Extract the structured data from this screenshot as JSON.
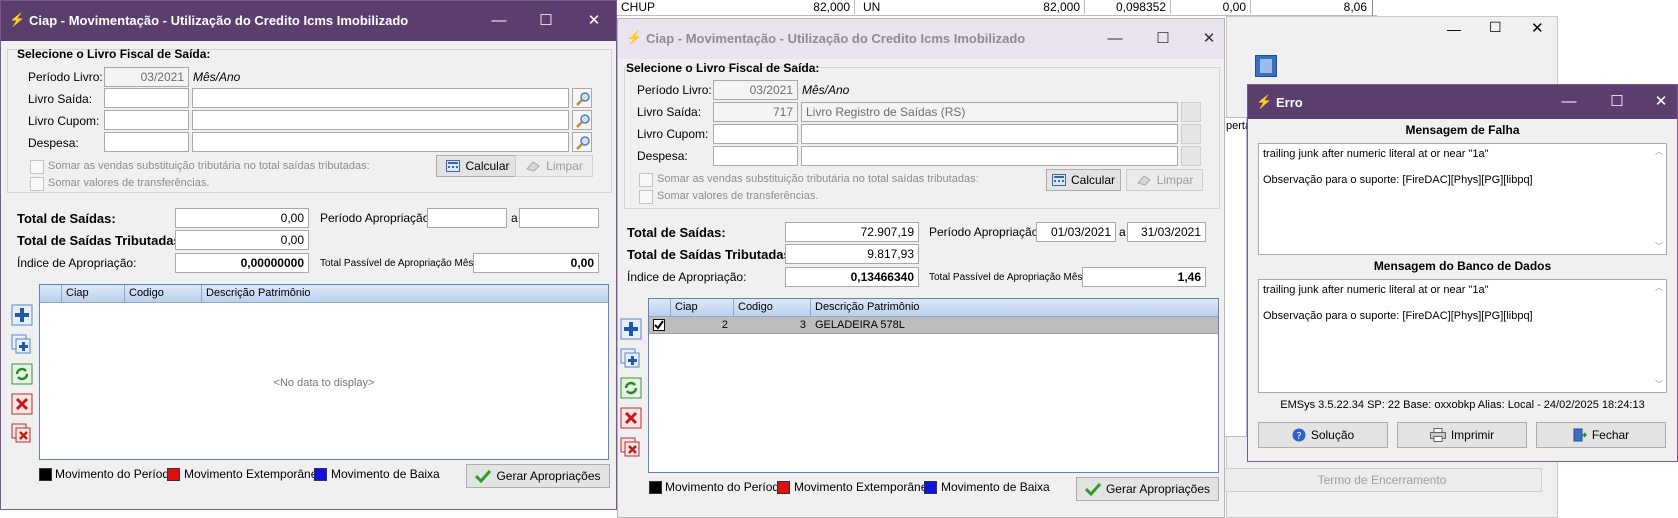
{
  "background": {
    "top_row": {
      "c1": "CHUP",
      "c2": "82,000",
      "c3": "UN",
      "c4": "82,000",
      "c5": "0,098352",
      "c6": "0,00",
      "c7": "8,06"
    },
    "tab_partial": "perta",
    "footer_button": "Termo de Encerramento"
  },
  "window1": {
    "title": "Ciap - Movimentação - Utilização do Credito Icms Imobilizado",
    "section_title": "Selecione o Livro Fiscal de Saída:",
    "periodo_label": "Período Livro:",
    "periodo_value": "03/2021",
    "mes_ano": "Mês/Ano",
    "livro_saida_label": "Livro Saída:",
    "livro_saida_code": "",
    "livro_saida_desc": "",
    "livro_cupom_label": "Livro Cupom:",
    "despesa_label": "Despesa:",
    "chk1_label": "Somar as vendas substituição tributária no total saídas tributadas:",
    "chk2_label": "Somar valores de transferências.",
    "calcular": "Calcular",
    "limpar": "Limpar",
    "total_saidas_label": "Total de Saídas:",
    "total_saidas_value": "0,00",
    "total_trib_label": "Total de Saídas Tributadas:",
    "total_trib_value": "0,00",
    "indice_label": "Índice de Apropriação:",
    "indice_value": "0,00000000",
    "periodo_aprop_label": "Período Apropriação:",
    "periodo_aprop_from": "",
    "a_label": "a",
    "periodo_aprop_to": "",
    "passivel_label": "Total Passível de Apropriação Mês:",
    "passivel_value": "0,00",
    "grid_cols": [
      "Ciap",
      "Codigo",
      "Descrição Patrimônio"
    ],
    "no_data": "<No data to display>",
    "legend": [
      "Movimento do Período",
      "Movimento Extemporâneo",
      "Movimento de Baixa"
    ],
    "gerar": "Gerar Apropriações"
  },
  "window2": {
    "title": "Ciap - Movimentação - Utilização do Credito Icms Imobilizado",
    "section_title": "Selecione o Livro Fiscal de Saída:",
    "periodo_label": "Período Livro:",
    "periodo_value": "03/2021",
    "mes_ano": "Mês/Ano",
    "livro_saida_label": "Livro Saída:",
    "livro_saida_code": "717",
    "livro_saida_desc": "Livro Registro de Saídas (RS)",
    "livro_cupom_label": "Livro Cupom:",
    "despesa_label": "Despesa:",
    "chk1_label": "Somar as vendas substituição tributária no total saídas tributadas:",
    "chk2_label": "Somar valores de transferências.",
    "calcular": "Calcular",
    "limpar": "Limpar",
    "total_saidas_label": "Total de Saídas:",
    "total_saidas_value": "72.907,19",
    "total_trib_label": "Total de Saídas Tributadas:",
    "total_trib_value": "9.817,93",
    "indice_label": "Índice de Apropriação:",
    "indice_value": "0,13466340",
    "periodo_aprop_label": "Período Apropriação:",
    "periodo_aprop_from": "01/03/2021",
    "a_label": "a",
    "periodo_aprop_to": "31/03/2021",
    "passivel_label": "Total Passível de Apropriação Mês:",
    "passivel_value": "1,46",
    "grid_cols": [
      "Ciap",
      "Codigo",
      "Descrição Patrimônio"
    ],
    "rows": [
      {
        "ciap": "2",
        "codigo": "3",
        "descricao": "GELADEIRA 578L"
      }
    ],
    "legend": [
      "Movimento do Período",
      "Movimento Extemporâneo",
      "Movimento de Baixa"
    ],
    "gerar": "Gerar Apropriações"
  },
  "error": {
    "title": "Erro",
    "falha_header": "Mensagem de Falha",
    "falha_line1": "trailing junk after numeric literal at or near \"1a\"",
    "falha_line2": "Observação para o suporte: [FireDAC][Phys][PG][libpq]",
    "banco_header": "Mensagem do Banco de Dados",
    "banco_line1": "trailing junk after numeric literal at or near \"1a\"",
    "banco_line2": "Observação para o suporte: [FireDAC][Phys][PG][libpq]",
    "info": "EMSys 3.5.22.34 SP: 22 Base: oxxobkp Alias: Local - 24/02/2025 18:24:13",
    "solucao": "Solução",
    "imprimir": "Imprimir",
    "fechar": "Fechar"
  },
  "colors": {
    "titlebar": "#5a3f6e",
    "grid_border": "#6482b8",
    "legend_periodo": "#000000",
    "legend_extemporaneo": "#e01010",
    "legend_baixa": "#1010e0"
  }
}
